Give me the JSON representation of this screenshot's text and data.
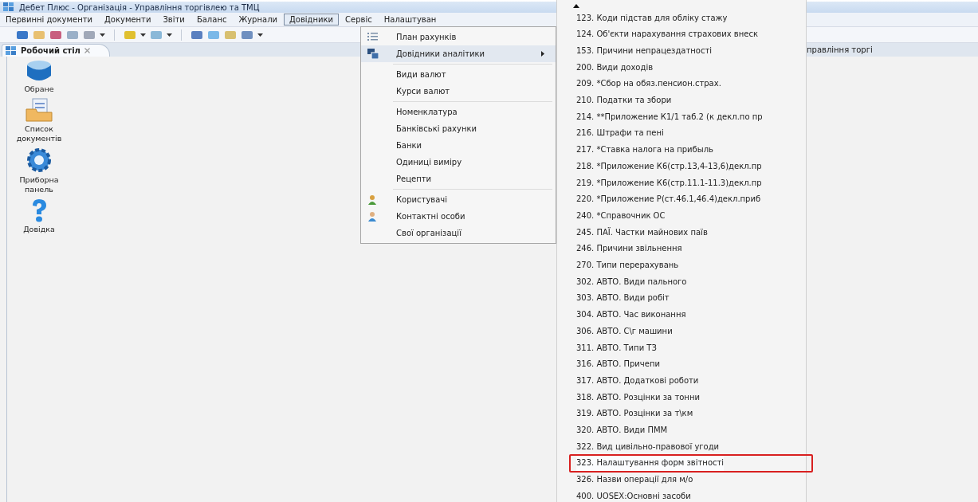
{
  "window": {
    "title": "Дебет Плюс - Організація - Управління торгівлею та ТМЦ"
  },
  "menubar": [
    {
      "label": "Первинні документи",
      "selected": false
    },
    {
      "label": "Документи",
      "selected": false
    },
    {
      "label": "Звіти",
      "selected": false
    },
    {
      "label": "Баланс",
      "selected": false
    },
    {
      "label": "Журнали",
      "selected": false
    },
    {
      "label": "Довідники",
      "selected": true
    },
    {
      "label": "Сервіс",
      "selected": false
    },
    {
      "label": "Налаштуван",
      "selected": false
    }
  ],
  "tabs": [
    {
      "label": "Робочий стіл",
      "selected": true
    }
  ],
  "perspective_label": "правління торгі",
  "desktop_icons": [
    {
      "label": "Обране"
    },
    {
      "label": "Список документів"
    },
    {
      "label": "Приборна панель"
    },
    {
      "label": "Довідка"
    }
  ],
  "menu": {
    "items": [
      {
        "kind": "item",
        "label": "План рахунків",
        "submenu": false,
        "selected": false
      },
      {
        "kind": "item",
        "label": "Довідники аналітики",
        "submenu": true,
        "selected": true
      },
      {
        "kind": "separator"
      },
      {
        "kind": "item",
        "label": "Види валют",
        "submenu": false,
        "selected": false
      },
      {
        "kind": "item",
        "label": "Курси валют",
        "submenu": false,
        "selected": false
      },
      {
        "kind": "separator"
      },
      {
        "kind": "item",
        "label": "Номенклатура",
        "submenu": false,
        "selected": false
      },
      {
        "kind": "item",
        "label": "Банківські рахунки",
        "submenu": false,
        "selected": false
      },
      {
        "kind": "item",
        "label": "Банки",
        "submenu": false,
        "selected": false
      },
      {
        "kind": "item",
        "label": "Одиниці виміру",
        "submenu": false,
        "selected": false
      },
      {
        "kind": "item",
        "label": "Рецепти",
        "submenu": false,
        "selected": false
      },
      {
        "kind": "separator"
      },
      {
        "kind": "item",
        "label": "Користувачі",
        "submenu": false,
        "selected": false
      },
      {
        "kind": "item",
        "label": "Контактні особи",
        "submenu": false,
        "selected": false
      },
      {
        "kind": "item",
        "label": "Свої організації",
        "submenu": false,
        "selected": false
      }
    ]
  },
  "submenu": {
    "items": [
      {
        "label": "123. Коди підстав для обліку стажу",
        "highlighted": false
      },
      {
        "label": "124. Об'єкти нарахування страхових внеск",
        "highlighted": false
      },
      {
        "label": "153. Причини непрацездатності",
        "highlighted": false
      },
      {
        "label": "200. Види доходів",
        "highlighted": false
      },
      {
        "label": "209. *Сбор на обяз.пенсион.страх.",
        "highlighted": false
      },
      {
        "label": "210. Податки та збори",
        "highlighted": false
      },
      {
        "label": "214. **Приложение К1/1 таб.2 (к декл.по пр",
        "highlighted": false
      },
      {
        "label": "216. Штрафи та пені",
        "highlighted": false
      },
      {
        "label": "217. *Ставка налога на прибыль",
        "highlighted": false
      },
      {
        "label": "218. *Приложение К6(стр.13,4-13,6)декл.пр",
        "highlighted": false
      },
      {
        "label": "219. *Приложение К6(стр.11.1-11.3)декл.пр",
        "highlighted": false
      },
      {
        "label": "220. *Приложение Р(ст.46.1,46.4)декл.приб",
        "highlighted": false
      },
      {
        "label": "240. *Справочник ОС",
        "highlighted": false
      },
      {
        "label": "245. ПАЇ. Частки майнових паїв",
        "highlighted": false
      },
      {
        "label": "246. Причини звільнення",
        "highlighted": false
      },
      {
        "label": "270. Типи перерахувань",
        "highlighted": false
      },
      {
        "label": "302. АВТО. Види пального",
        "highlighted": false
      },
      {
        "label": "303. АВТО. Види робіт",
        "highlighted": false
      },
      {
        "label": "304. АВТО. Час виконання",
        "highlighted": false
      },
      {
        "label": "306. АВТО. С\\г машини",
        "highlighted": false
      },
      {
        "label": "311. АВТО. Типи ТЗ",
        "highlighted": false
      },
      {
        "label": "316. АВТО. Причепи",
        "highlighted": false
      },
      {
        "label": "317. АВТО. Додаткові роботи",
        "highlighted": false
      },
      {
        "label": "318. АВТО. Розцінки за тонни",
        "highlighted": false
      },
      {
        "label": "319. АВТО. Розцінки за т\\км",
        "highlighted": false
      },
      {
        "label": "320. АВТО. Види ПММ",
        "highlighted": false
      },
      {
        "label": "322. Вид цивільно-правової угоди",
        "highlighted": false
      },
      {
        "label": "323. Налаштування форм звітності",
        "highlighted": true
      },
      {
        "label": "326. Назви операції для м/о",
        "highlighted": false
      },
      {
        "label": "400. UOSEX:Основні засоби",
        "highlighted": false
      }
    ]
  }
}
